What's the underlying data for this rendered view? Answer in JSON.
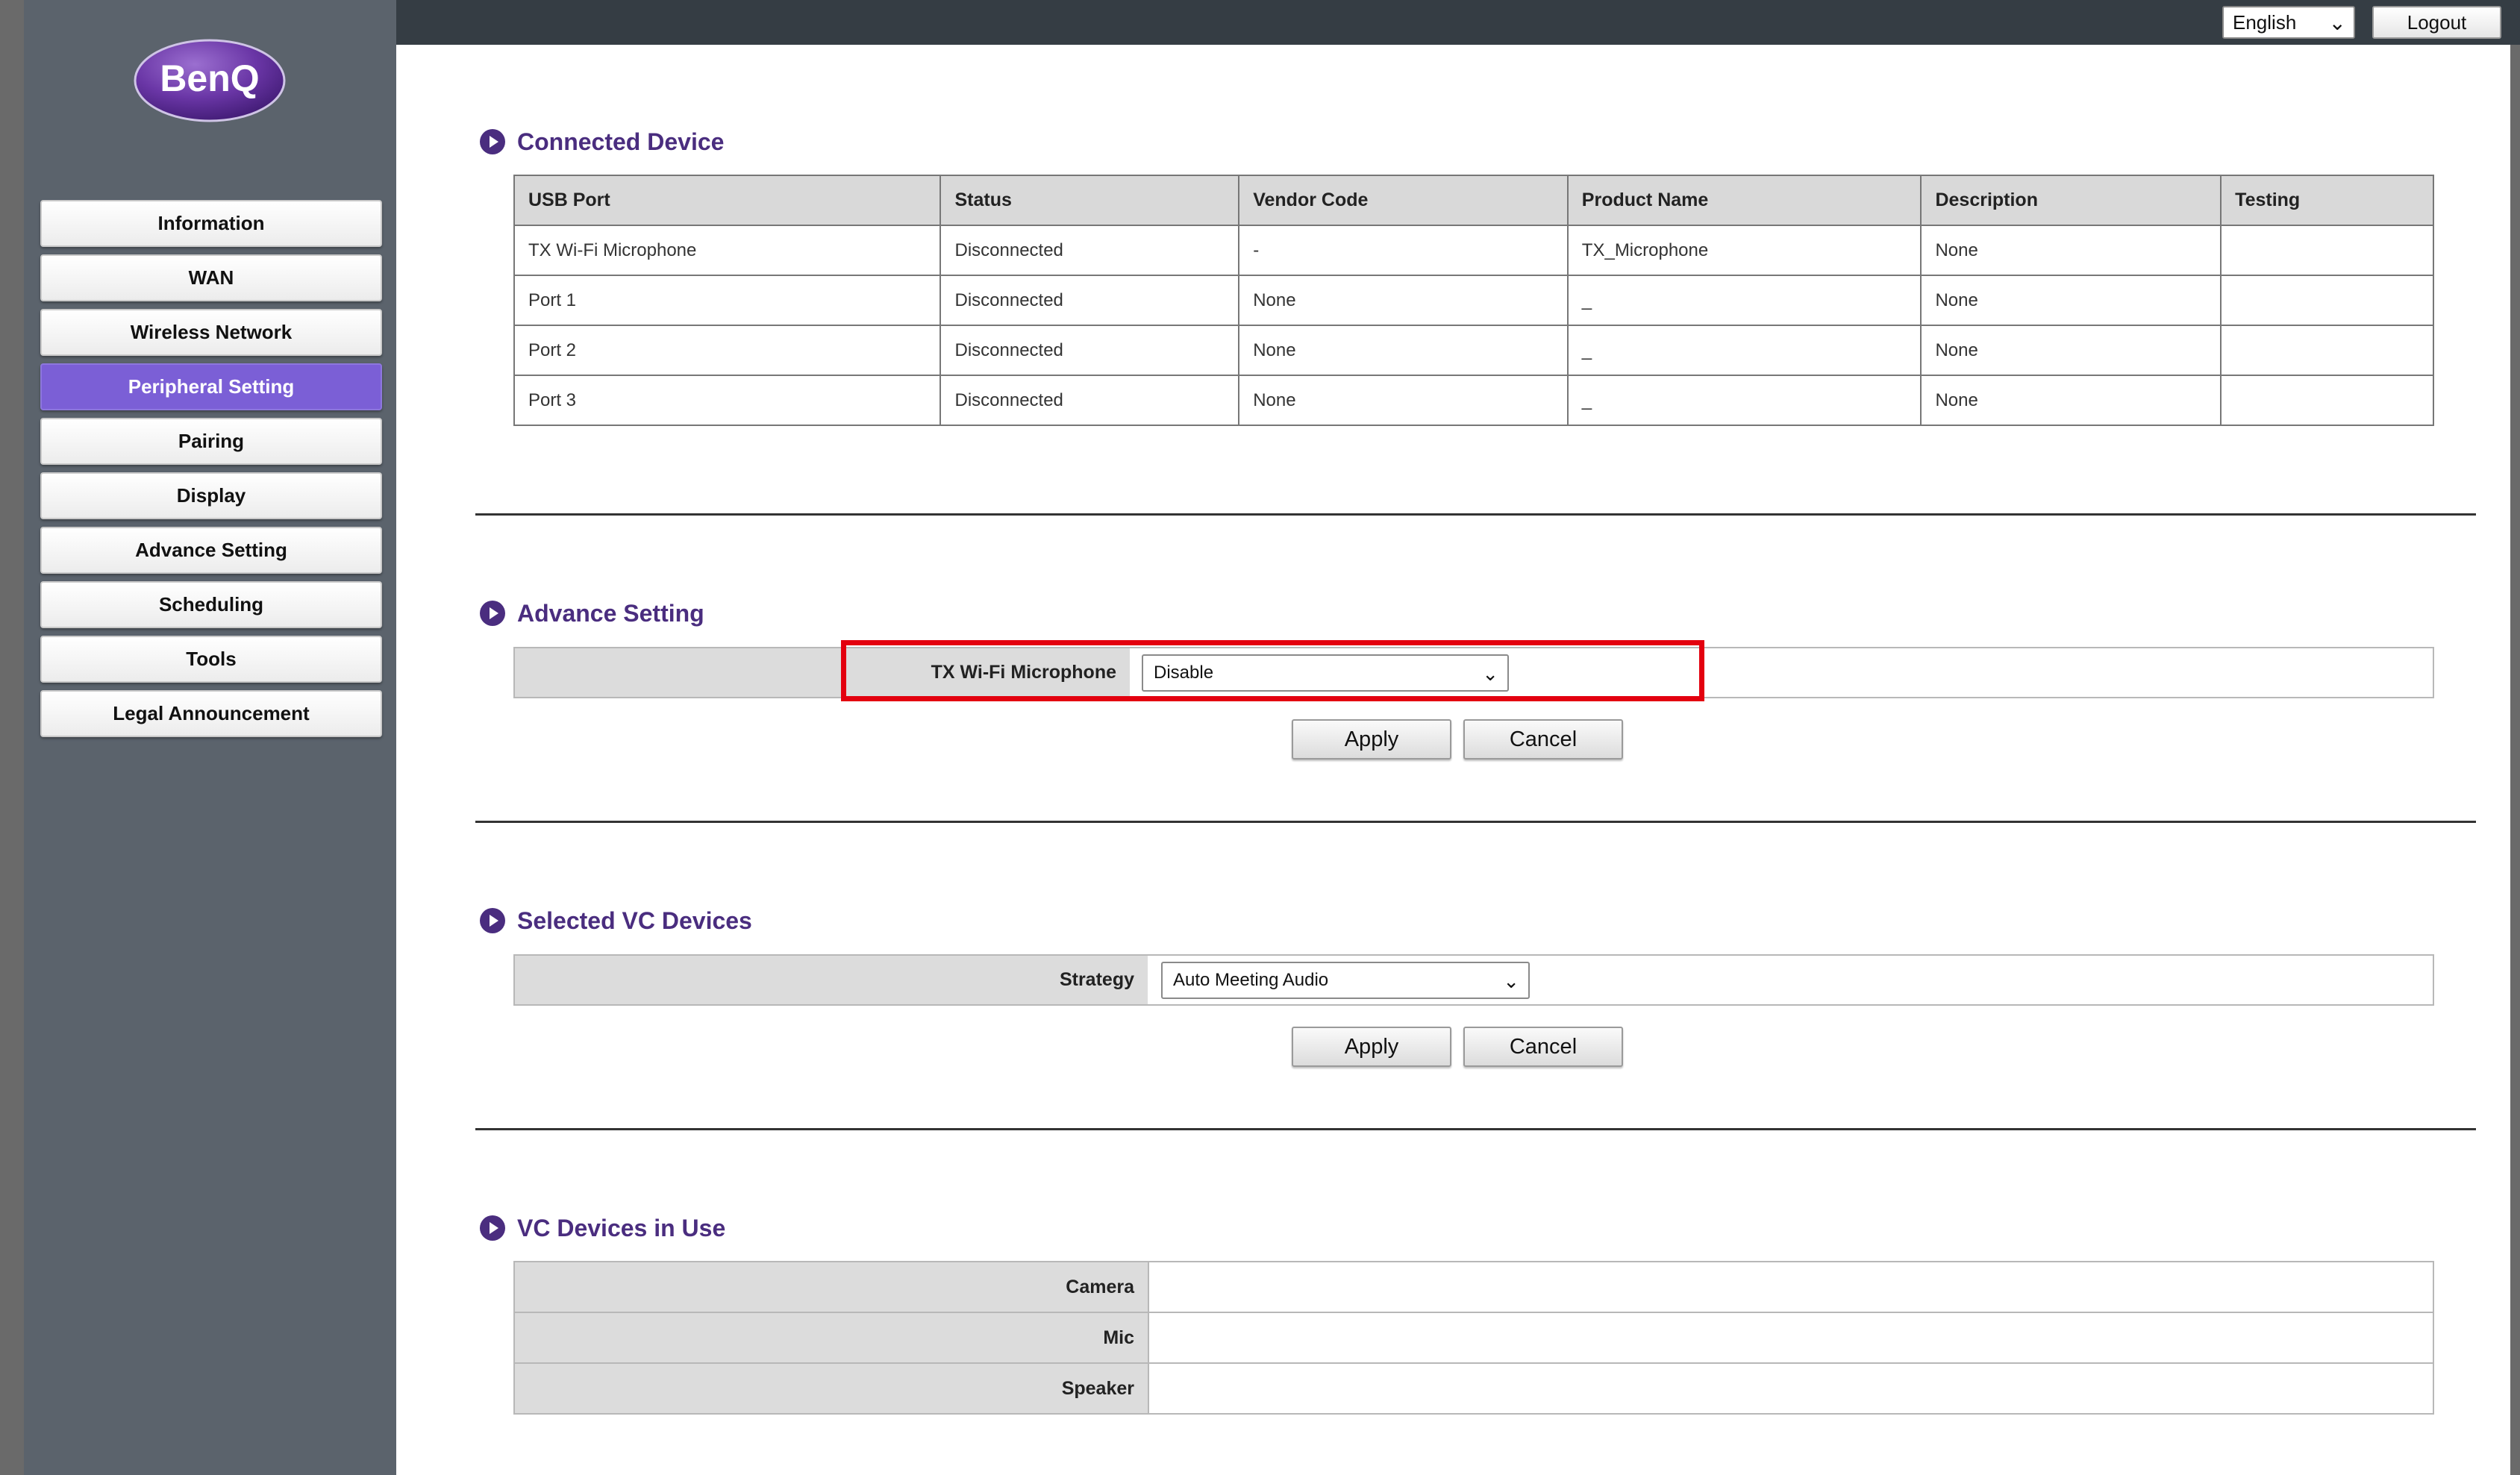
{
  "header": {
    "language": "English",
    "logout_label": "Logout"
  },
  "logo": {
    "text": "BenQ",
    "color": "#5a2d91"
  },
  "sidebar": {
    "items": [
      {
        "label": "Information"
      },
      {
        "label": "WAN"
      },
      {
        "label": "Wireless Network"
      },
      {
        "label": "Peripheral Setting",
        "active": true
      },
      {
        "label": "Pairing"
      },
      {
        "label": "Display"
      },
      {
        "label": "Advance Setting"
      },
      {
        "label": "Scheduling"
      },
      {
        "label": "Tools"
      },
      {
        "label": "Legal Announcement"
      }
    ],
    "active_color": "#7b5fd6"
  },
  "connected_device": {
    "title": "Connected Device",
    "columns": [
      "USB Port",
      "Status",
      "Vendor Code",
      "Product Name",
      "Description",
      "Testing"
    ],
    "rows": [
      [
        "TX Wi-Fi Microphone",
        "Disconnected",
        "-",
        "TX_Microphone",
        "None",
        ""
      ],
      [
        "Port 1",
        "Disconnected",
        "None",
        "_",
        "None",
        ""
      ],
      [
        "Port 2",
        "Disconnected",
        "None",
        "_",
        "None",
        ""
      ],
      [
        "Port 3",
        "Disconnected",
        "None",
        "_",
        "None",
        ""
      ]
    ]
  },
  "advance_setting": {
    "title": "Advance Setting",
    "field_label": "TX Wi-Fi Microphone",
    "field_value": "Disable",
    "apply_label": "Apply",
    "cancel_label": "Cancel",
    "highlight_color": "#e3000f"
  },
  "selected_vc": {
    "title": "Selected VC Devices",
    "field_label": "Strategy",
    "field_value": "Auto Meeting Audio",
    "apply_label": "Apply",
    "cancel_label": "Cancel"
  },
  "vc_in_use": {
    "title": "VC Devices in Use",
    "rows": [
      {
        "label": "Camera",
        "value": ""
      },
      {
        "label": "Mic",
        "value": ""
      },
      {
        "label": "Speaker",
        "value": ""
      }
    ]
  },
  "colors": {
    "section_title": "#4a2d7f",
    "sidebar_bg": "#5b636c",
    "topbar_bg": "#353d44"
  }
}
